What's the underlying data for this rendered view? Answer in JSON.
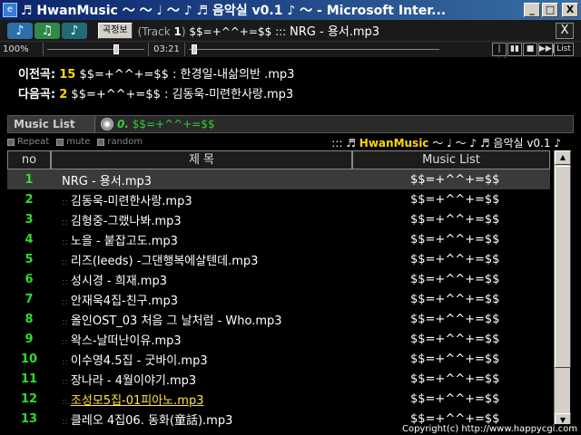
{
  "window": {
    "title": "♬ HwanMusic ～ ～ ♩ ～ ♪ ♬ 음악실 v0.1 ♪ ～ - Microsoft Inter...",
    "icon": "ie-icon",
    "min": "_",
    "max": "□",
    "close": "X"
  },
  "topbar": {
    "notes": [
      "♪",
      "♫",
      "♪"
    ],
    "song_info_label": "곡정보",
    "track_prefix": "(Track ",
    "track_num": "1",
    "track_suffix": ")",
    "marker": "$$=+^^+=$$ :::",
    "current_song": "NRG - 용서.mp3",
    "close_label": "X"
  },
  "progress": {
    "volume": "100%",
    "volume_level": 0.7,
    "time": "03:21",
    "seek_level": 0.01,
    "controls": [
      "|◀◀",
      "▮▮",
      "■",
      "▶▶|",
      "List"
    ]
  },
  "prevnext": {
    "prev_label": "이전곡:",
    "prev_num": "15",
    "prev_text": "$$=+^^+=$$ : 한경일-내삶의반 .mp3",
    "next_label": "다음곡:",
    "next_num": "2",
    "next_text": "$$=+^^+=$$ : 김동욱-미련한사랑.mp3"
  },
  "musiclist": {
    "tab_label": "Music List",
    "now": "0.",
    "now_marker": "$$=+^^+=$$"
  },
  "options": {
    "repeat": "Repeat",
    "mute": "mute",
    "random": "random",
    "brand_prefix": "::: ♬",
    "brand_name": "HwanMusic",
    "brand_suffix": "～ ♩ ～ ♪ ♬ 음악실 v0.1 ♪"
  },
  "table": {
    "headers": {
      "no": "no",
      "title": "제 목",
      "ml": "Music List"
    },
    "rows": [
      {
        "no": "1",
        "title": "NRG - 용서.mp3",
        "ml": "$$=+^^+=$$"
      },
      {
        "no": "2",
        "title": "김동욱-미련한사랑.mp3",
        "ml": "$$=+^^+=$$"
      },
      {
        "no": "3",
        "title": "김형중-그랬나봐.mp3",
        "ml": "$$=+^^+=$$"
      },
      {
        "no": "4",
        "title": "노을 - 붙잡고도.mp3",
        "ml": "$$=+^^+=$$"
      },
      {
        "no": "5",
        "title": "리즈(leeds) -그댄행복에살텐데.mp3",
        "ml": "$$=+^^+=$$"
      },
      {
        "no": "6",
        "title": "성시경 - 희재.mp3",
        "ml": "$$=+^^+=$$"
      },
      {
        "no": "7",
        "title": "안재욱4집-친구.mp3",
        "ml": "$$=+^^+=$$"
      },
      {
        "no": "8",
        "title": "올인OST_03 처음 그 날처럼 - Who.mp3",
        "ml": "$$=+^^+=$$"
      },
      {
        "no": "9",
        "title": "왁스-날떠난이유.mp3",
        "ml": "$$=+^^+=$$"
      },
      {
        "no": "10",
        "title": "이수영4.5집 - 굿바이.mp3",
        "ml": "$$=+^^+=$$"
      },
      {
        "no": "11",
        "title": "장나라 - 4월이야기.mp3",
        "ml": "$$=+^^+=$$"
      },
      {
        "no": "12",
        "title": "조성모5집-01피아노.mp3",
        "ml": "$$=+^^+=$$"
      },
      {
        "no": "13",
        "title": "클레오 4집06. 동화(童話).mp3",
        "ml": "$$=+^^+=$$"
      }
    ],
    "selected": 0,
    "highlighted": 11
  },
  "footer": {
    "copyright": "Copyright(c) http://www.happycgi.com"
  }
}
